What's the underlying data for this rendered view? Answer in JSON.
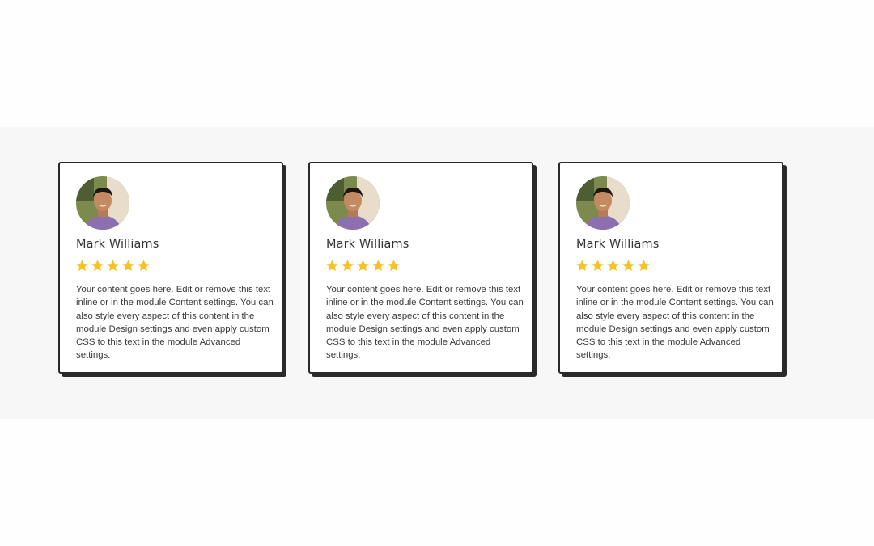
{
  "testimonials": [
    {
      "name": "Mark Williams",
      "rating": 5,
      "rating_max": 5,
      "text": "Your content goes here. Edit or remove this text inline or in the module Content settings. You can also style every aspect of this content in the module Design settings and even apply custom CSS to this text in the module Advanced settings."
    },
    {
      "name": "Mark Williams",
      "rating": 5,
      "rating_max": 5,
      "text": "Your content goes here. Edit or remove this text inline or in the module Content settings. You can also style every aspect of this content in the module Design settings and even apply custom CSS to this text in the module Advanced settings."
    },
    {
      "name": "Mark Williams",
      "rating": 5,
      "rating_max": 5,
      "text": "Your content goes here. Edit or remove this text inline or in the module Content settings. You can also style every aspect of this content in the module Design settings and even apply custom CSS to this text in the module Advanced settings."
    }
  ],
  "colors": {
    "star": "#f6c325",
    "card_border": "#2a2a2a",
    "band_background": "#f7f7f7",
    "name_text": "#333333",
    "body_text": "#3a3a3a"
  },
  "icons": {
    "rating": "star-icon",
    "avatar": "avatar-photo"
  }
}
